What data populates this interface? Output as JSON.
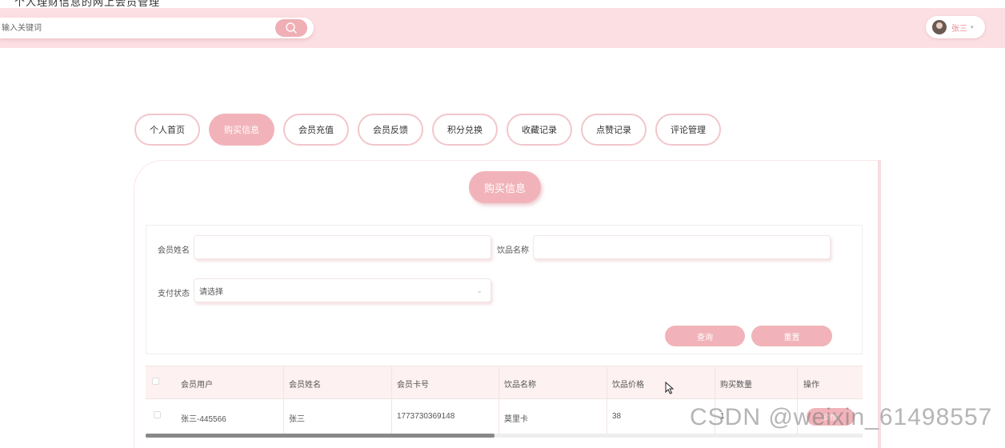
{
  "app": {
    "title": "个人理财信息的网上会员管理"
  },
  "header": {
    "search_placeholder": "输入关键词",
    "user_name": "张三",
    "user_caret": "▾"
  },
  "tabs": [
    {
      "label": "个人首页",
      "active": false
    },
    {
      "label": "购买信息",
      "active": true
    },
    {
      "label": "会员充值",
      "active": false
    },
    {
      "label": "会员反馈",
      "active": false
    },
    {
      "label": "积分兑换",
      "active": false
    },
    {
      "label": "收藏记录",
      "active": false
    },
    {
      "label": "点赞记录",
      "active": false
    },
    {
      "label": "评论管理",
      "active": false
    }
  ],
  "section": {
    "title": "购买信息"
  },
  "form": {
    "member_name_label": "会员姓名",
    "member_name_value": "",
    "drink_name_label": "饮品名称",
    "drink_name_value": "",
    "pay_status_label": "支付状态",
    "pay_status_value": "请选择",
    "query_label": "查询",
    "reset_label": "重置"
  },
  "table": {
    "headers": [
      "会员用户",
      "会员姓名",
      "会员卡号",
      "饮品名称",
      "饮品价格",
      "购买数量",
      "操作"
    ],
    "rows": [
      {
        "user": "张三-445566",
        "name": "张三",
        "card": "1773730369148",
        "drink": "莫里卡",
        "price": "38",
        "qty": "1",
        "action": "详情"
      }
    ]
  },
  "watermark": "CSDN @weixin_61498557",
  "colors": {
    "accent": "#f1b3b9",
    "header_bg": "#fcdfe3",
    "user_text": "#e58d98"
  },
  "icons": {
    "search": "search-icon",
    "chevron": "chevron-down-icon",
    "cursor": "mouse-cursor-icon"
  }
}
